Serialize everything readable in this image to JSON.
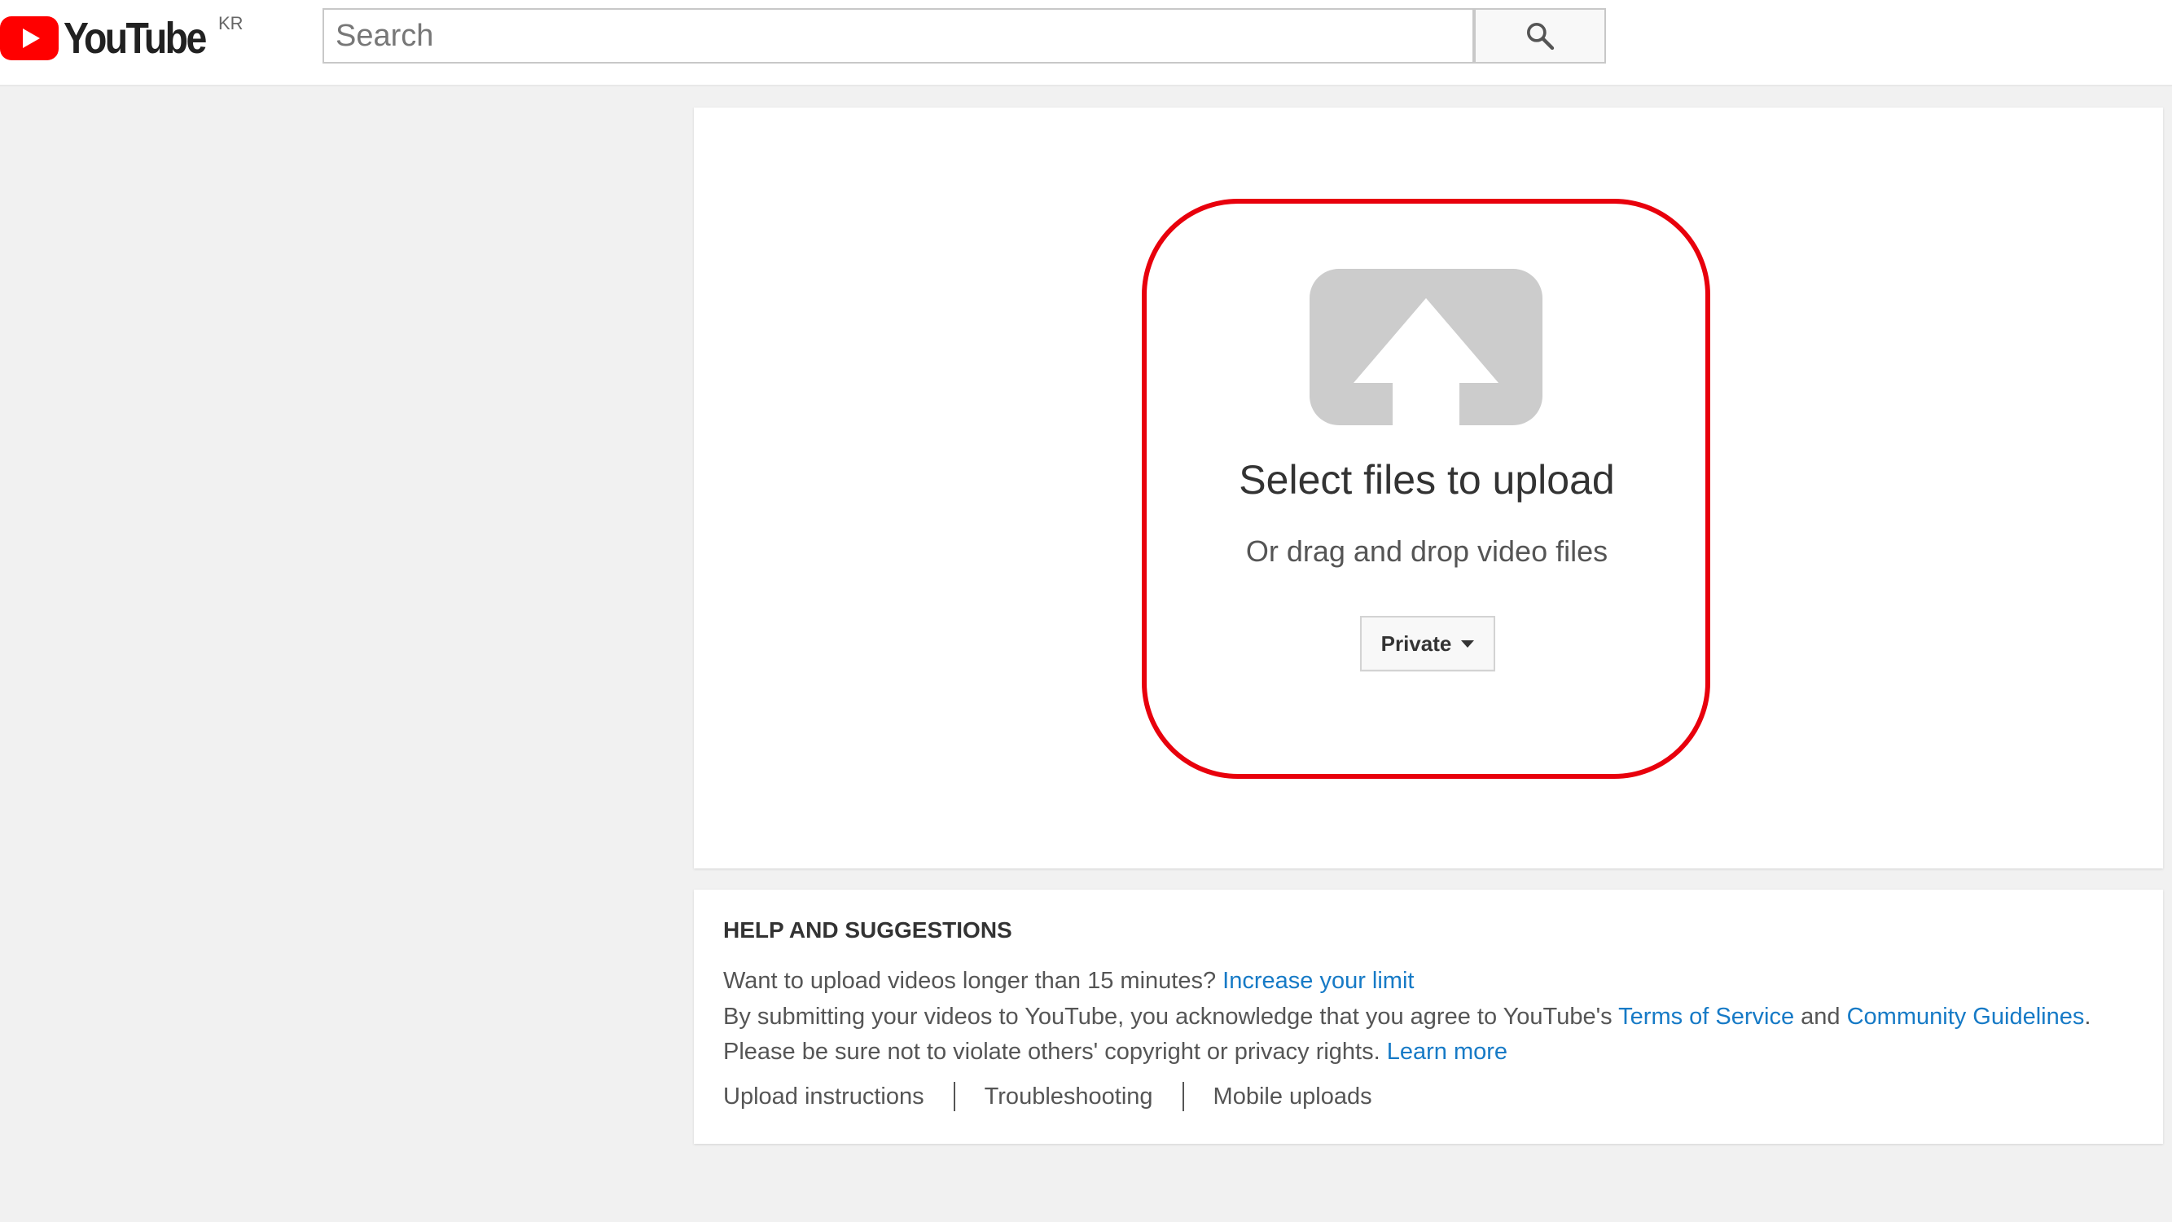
{
  "header": {
    "logo_text": "YouTube",
    "region_code": "KR",
    "search_placeholder": "Search"
  },
  "upload": {
    "title": "Select files to upload",
    "subtitle": "Or drag and drop video files",
    "privacy_value": "Private"
  },
  "help": {
    "heading": "HELP AND SUGGESTIONS",
    "line1_text": "Want to upload videos longer than 15 minutes? ",
    "line1_link": "Increase your limit",
    "line2_text": "By submitting your videos to YouTube, you acknowledge that you agree to YouTube's ",
    "line2_link1": "Terms of Service",
    "line2_mid": " and ",
    "line2_link2": "Community Guidelines",
    "line2_end": ".",
    "line3_text": "Please be sure not to violate others' copyright or privacy rights. ",
    "line3_link": "Learn more",
    "footer_links": [
      "Upload instructions",
      "Troubleshooting",
      "Mobile uploads"
    ]
  },
  "colors": {
    "brand_red": "#ff0000",
    "highlight_red": "#e8000c",
    "link_blue": "#167ac6",
    "upload_icon_gray": "#cccccc"
  },
  "icons": {
    "logo": "youtube-play-icon",
    "search": "search-icon",
    "upload": "upload-arrow-icon",
    "dropdown": "caret-down-icon"
  }
}
